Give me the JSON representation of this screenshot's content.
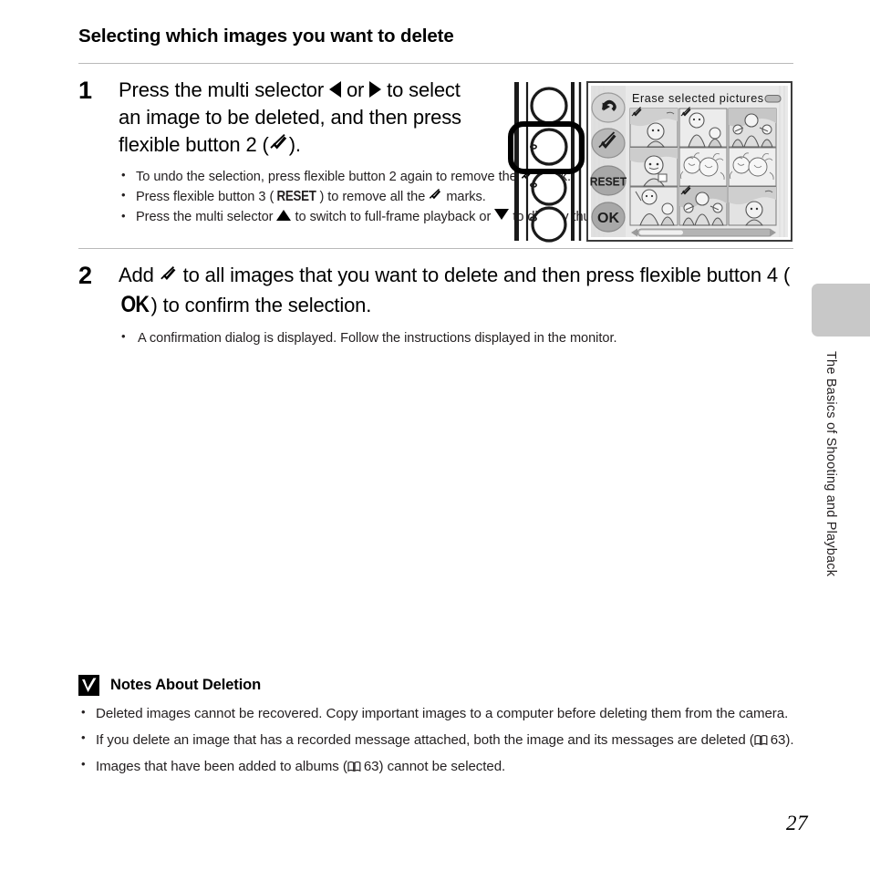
{
  "page": {
    "heading": "Selecting which images you want to delete",
    "number": "27",
    "margin_tab_text": "The Basics of Shooting and Playback"
  },
  "steps": [
    {
      "number": "1",
      "title_part1": "Press the multi selector ",
      "title_arrow_left": "left-arrow",
      "title_part2": " or ",
      "title_arrow_right": "right-arrow",
      "title_part3": " to select an image to be deleted, and then press flexible button 2 (",
      "title_check": "check-mark",
      "title_part4": ").",
      "bullets": [
        {
          "text_before": "To undo the selection, press flexible button 2 again to remove the ",
          "icon": "check-mark",
          "text_after": " mark."
        },
        {
          "text_before": "Press flexible button 3 (",
          "icon": "reset-label",
          "icon_label": "RESET",
          "text_mid": ") to remove all the ",
          "icon2": "check-mark",
          "text_after": " marks."
        },
        {
          "text_before": "Press the multi selector ",
          "icon": "up-arrow",
          "text_mid": " to switch to full-frame playback or ",
          "icon2": "down-arrow",
          "text_after": " to display thumbnails."
        }
      ]
    },
    {
      "number": "2",
      "title_part1": "Add ",
      "title_check": "check-mark",
      "title_part2": " to all images that you want to delete and then press flexible button 4 (",
      "title_ok": "OK",
      "title_part3": ") to confirm the selection.",
      "bullets": [
        {
          "text_before": "A confirmation dialog is displayed. Follow the instructions displayed in the monitor.",
          "icon": "",
          "text_after": ""
        }
      ]
    }
  ],
  "illustration": {
    "monitor_title": "Erase selected pictures",
    "side_buttons": [
      {
        "name": "back-button",
        "label": "↩"
      },
      {
        "name": "check-button",
        "label": "✓"
      },
      {
        "name": "reset-button",
        "label": "RESET"
      },
      {
        "name": "ok-button",
        "label": "OK"
      }
    ],
    "battery_icon": "battery-icon",
    "scrollbar": "horizontal-scrollbar",
    "thumbnails_marked": [
      1,
      7
    ],
    "thumbnail_count": 9,
    "highlighted_camera_button": 2
  },
  "notes": {
    "badge_icon": "warning-check-icon",
    "title": "Notes About Deletion",
    "items": [
      {
        "text_before": "Deleted images cannot be recovered. Copy important images to a computer before deleting them from the camera.",
        "ref_page": "",
        "text_after": ""
      },
      {
        "text_before": "If you delete an image that has a recorded message attached, both the image and its messages are deleted (",
        "ref_page": "63",
        "text_after": ")."
      },
      {
        "text_before": "Images that have been added to albums (",
        "ref_page": "63",
        "text_after": ") cannot be selected."
      }
    ]
  },
  "colors": {
    "rule": "#b9b9b9",
    "tab": "#c8c8c8",
    "body_text": "#231f20",
    "monitor_bg": "#e8e8e8"
  }
}
